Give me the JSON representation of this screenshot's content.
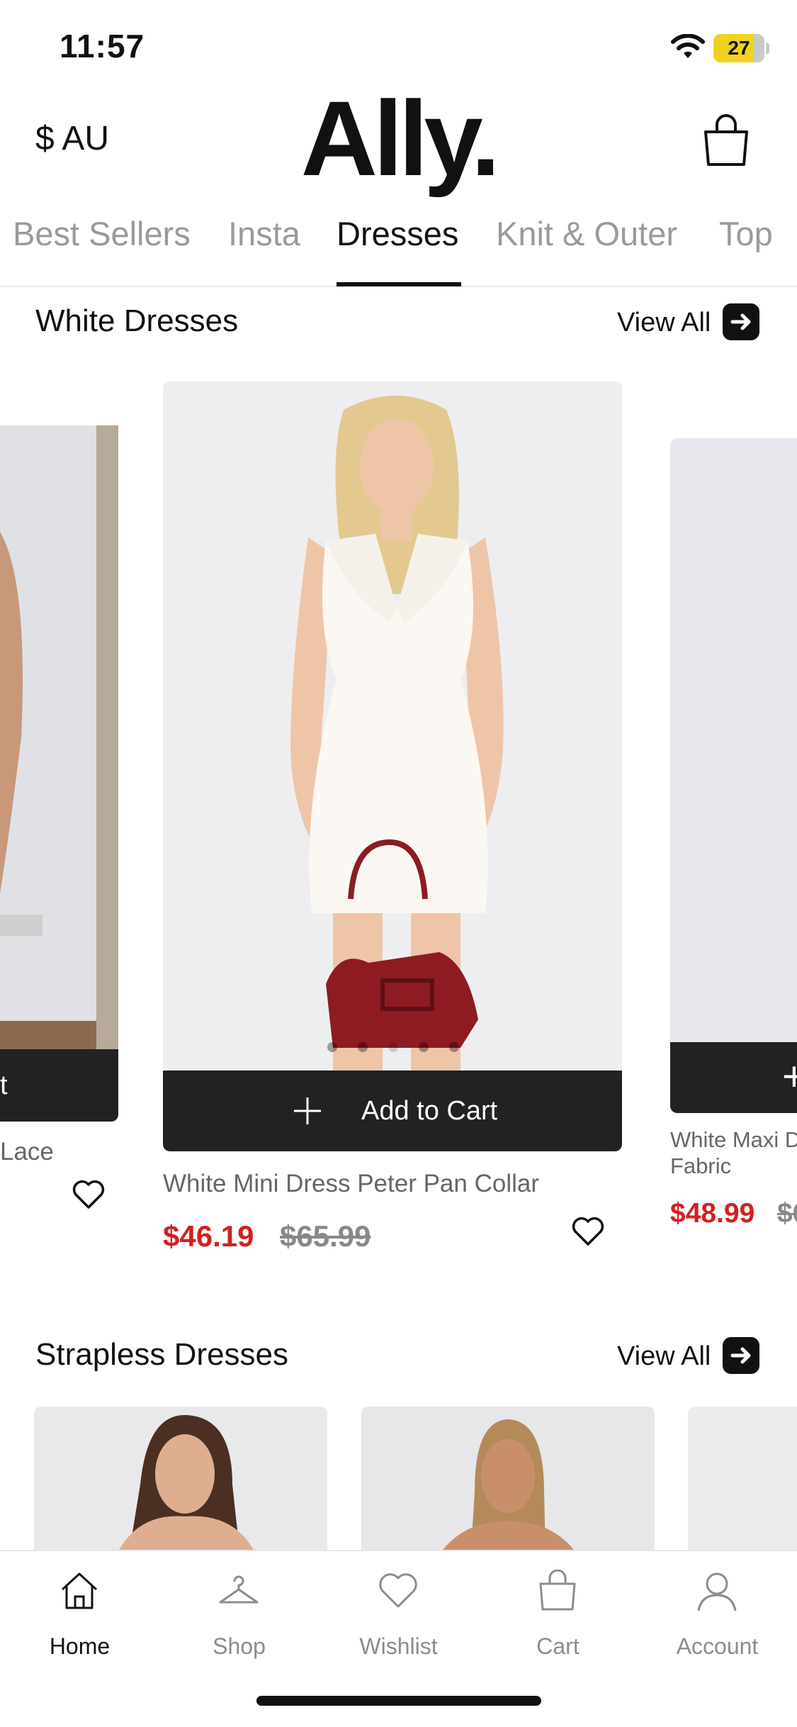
{
  "status_bar": {
    "time": "11:57",
    "battery": "27"
  },
  "header": {
    "currency": "$ AU",
    "logo": "Ally.",
    "icons": [
      "wifi-icon",
      "bag-icon"
    ]
  },
  "tabs": [
    {
      "label": "Best Sellers",
      "active": false
    },
    {
      "label": "Insta",
      "active": false
    },
    {
      "label": "Dresses",
      "active": true
    },
    {
      "label": "Knit & Outer",
      "active": false
    },
    {
      "label": "Top",
      "active": false
    }
  ],
  "sections": [
    {
      "title": "White Dresses",
      "view_all": "View All",
      "products": [
        {
          "name": "Lace",
          "cart_label": "t",
          "price": "",
          "old_price": ""
        },
        {
          "name": "White Mini Dress Peter Pan Collar",
          "cart_label": "Add to Cart",
          "price": "$46.19",
          "old_price": "$65.99",
          "image_count": 5
        },
        {
          "name": "White Maxi D",
          "name_line2": "Fabric",
          "cart_label": "+",
          "price": "$48.99",
          "old_price": "$6"
        }
      ]
    },
    {
      "title": "Strapless Dresses",
      "view_all": "View All"
    }
  ],
  "bottom_nav": [
    {
      "label": "Home",
      "icon": "home-icon",
      "active": true
    },
    {
      "label": "Shop",
      "icon": "hanger-icon",
      "active": false
    },
    {
      "label": "Wishlist",
      "icon": "heart-icon",
      "active": false
    },
    {
      "label": "Cart",
      "icon": "bag-icon",
      "active": false
    },
    {
      "label": "Account",
      "icon": "user-icon",
      "active": false
    }
  ],
  "colors": {
    "sale_price": "#d41f1f",
    "cart_bar": "#222222",
    "accent": "#111111"
  }
}
